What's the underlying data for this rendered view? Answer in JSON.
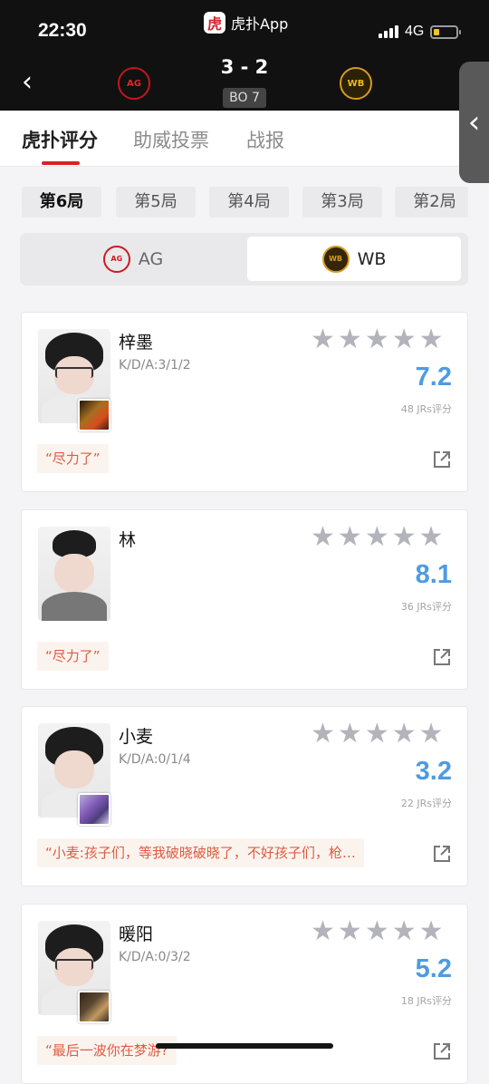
{
  "status": {
    "time": "22:30",
    "network": "4G",
    "battery_level": 0.25
  },
  "app": {
    "name": "虎扑App",
    "logo_text": "虎"
  },
  "match": {
    "score": "3 - 2",
    "format": "BO 7",
    "team_left": {
      "name": "AG",
      "logo_text": "AG"
    },
    "team_right": {
      "name": "WB",
      "logo_text": "WB"
    }
  },
  "tabs": [
    {
      "label": "虎扑评分",
      "active": true
    },
    {
      "label": "助威投票",
      "active": false
    },
    {
      "label": "战报",
      "active": false
    }
  ],
  "games": [
    {
      "label": "第6局",
      "active": true
    },
    {
      "label": "第5局",
      "active": false
    },
    {
      "label": "第4局",
      "active": false
    },
    {
      "label": "第3局",
      "active": false
    },
    {
      "label": "第2局",
      "active": false
    }
  ],
  "team_switch": [
    {
      "label": "AG",
      "logo_text": "AG",
      "active": false
    },
    {
      "label": "WB",
      "logo_text": "WB",
      "active": true
    }
  ],
  "players": [
    {
      "name": "梓墨",
      "kda": "K/D/A:3/1/2",
      "score": "7.2",
      "raters": "48 JRs评分",
      "quote": "“尽力了”"
    },
    {
      "name": "林",
      "kda": "",
      "score": "8.1",
      "raters": "36 JRs评分",
      "quote": "“尽力了”"
    },
    {
      "name": "小麦",
      "kda": "K/D/A:0/1/4",
      "score": "3.2",
      "raters": "22 JRs评分",
      "quote": "“小麦:孩子们，等我破晓破晓了，不好孩子们，枪…"
    },
    {
      "name": "暖阳",
      "kda": "K/D/A:0/3/2",
      "score": "5.2",
      "raters": "18 JRs评分",
      "quote": "“最后一波你在梦游?"
    }
  ],
  "icons": {
    "back": "back-arrow-icon",
    "star": "star-icon",
    "share": "share-icon",
    "side_handle": "side-handle-icon"
  }
}
